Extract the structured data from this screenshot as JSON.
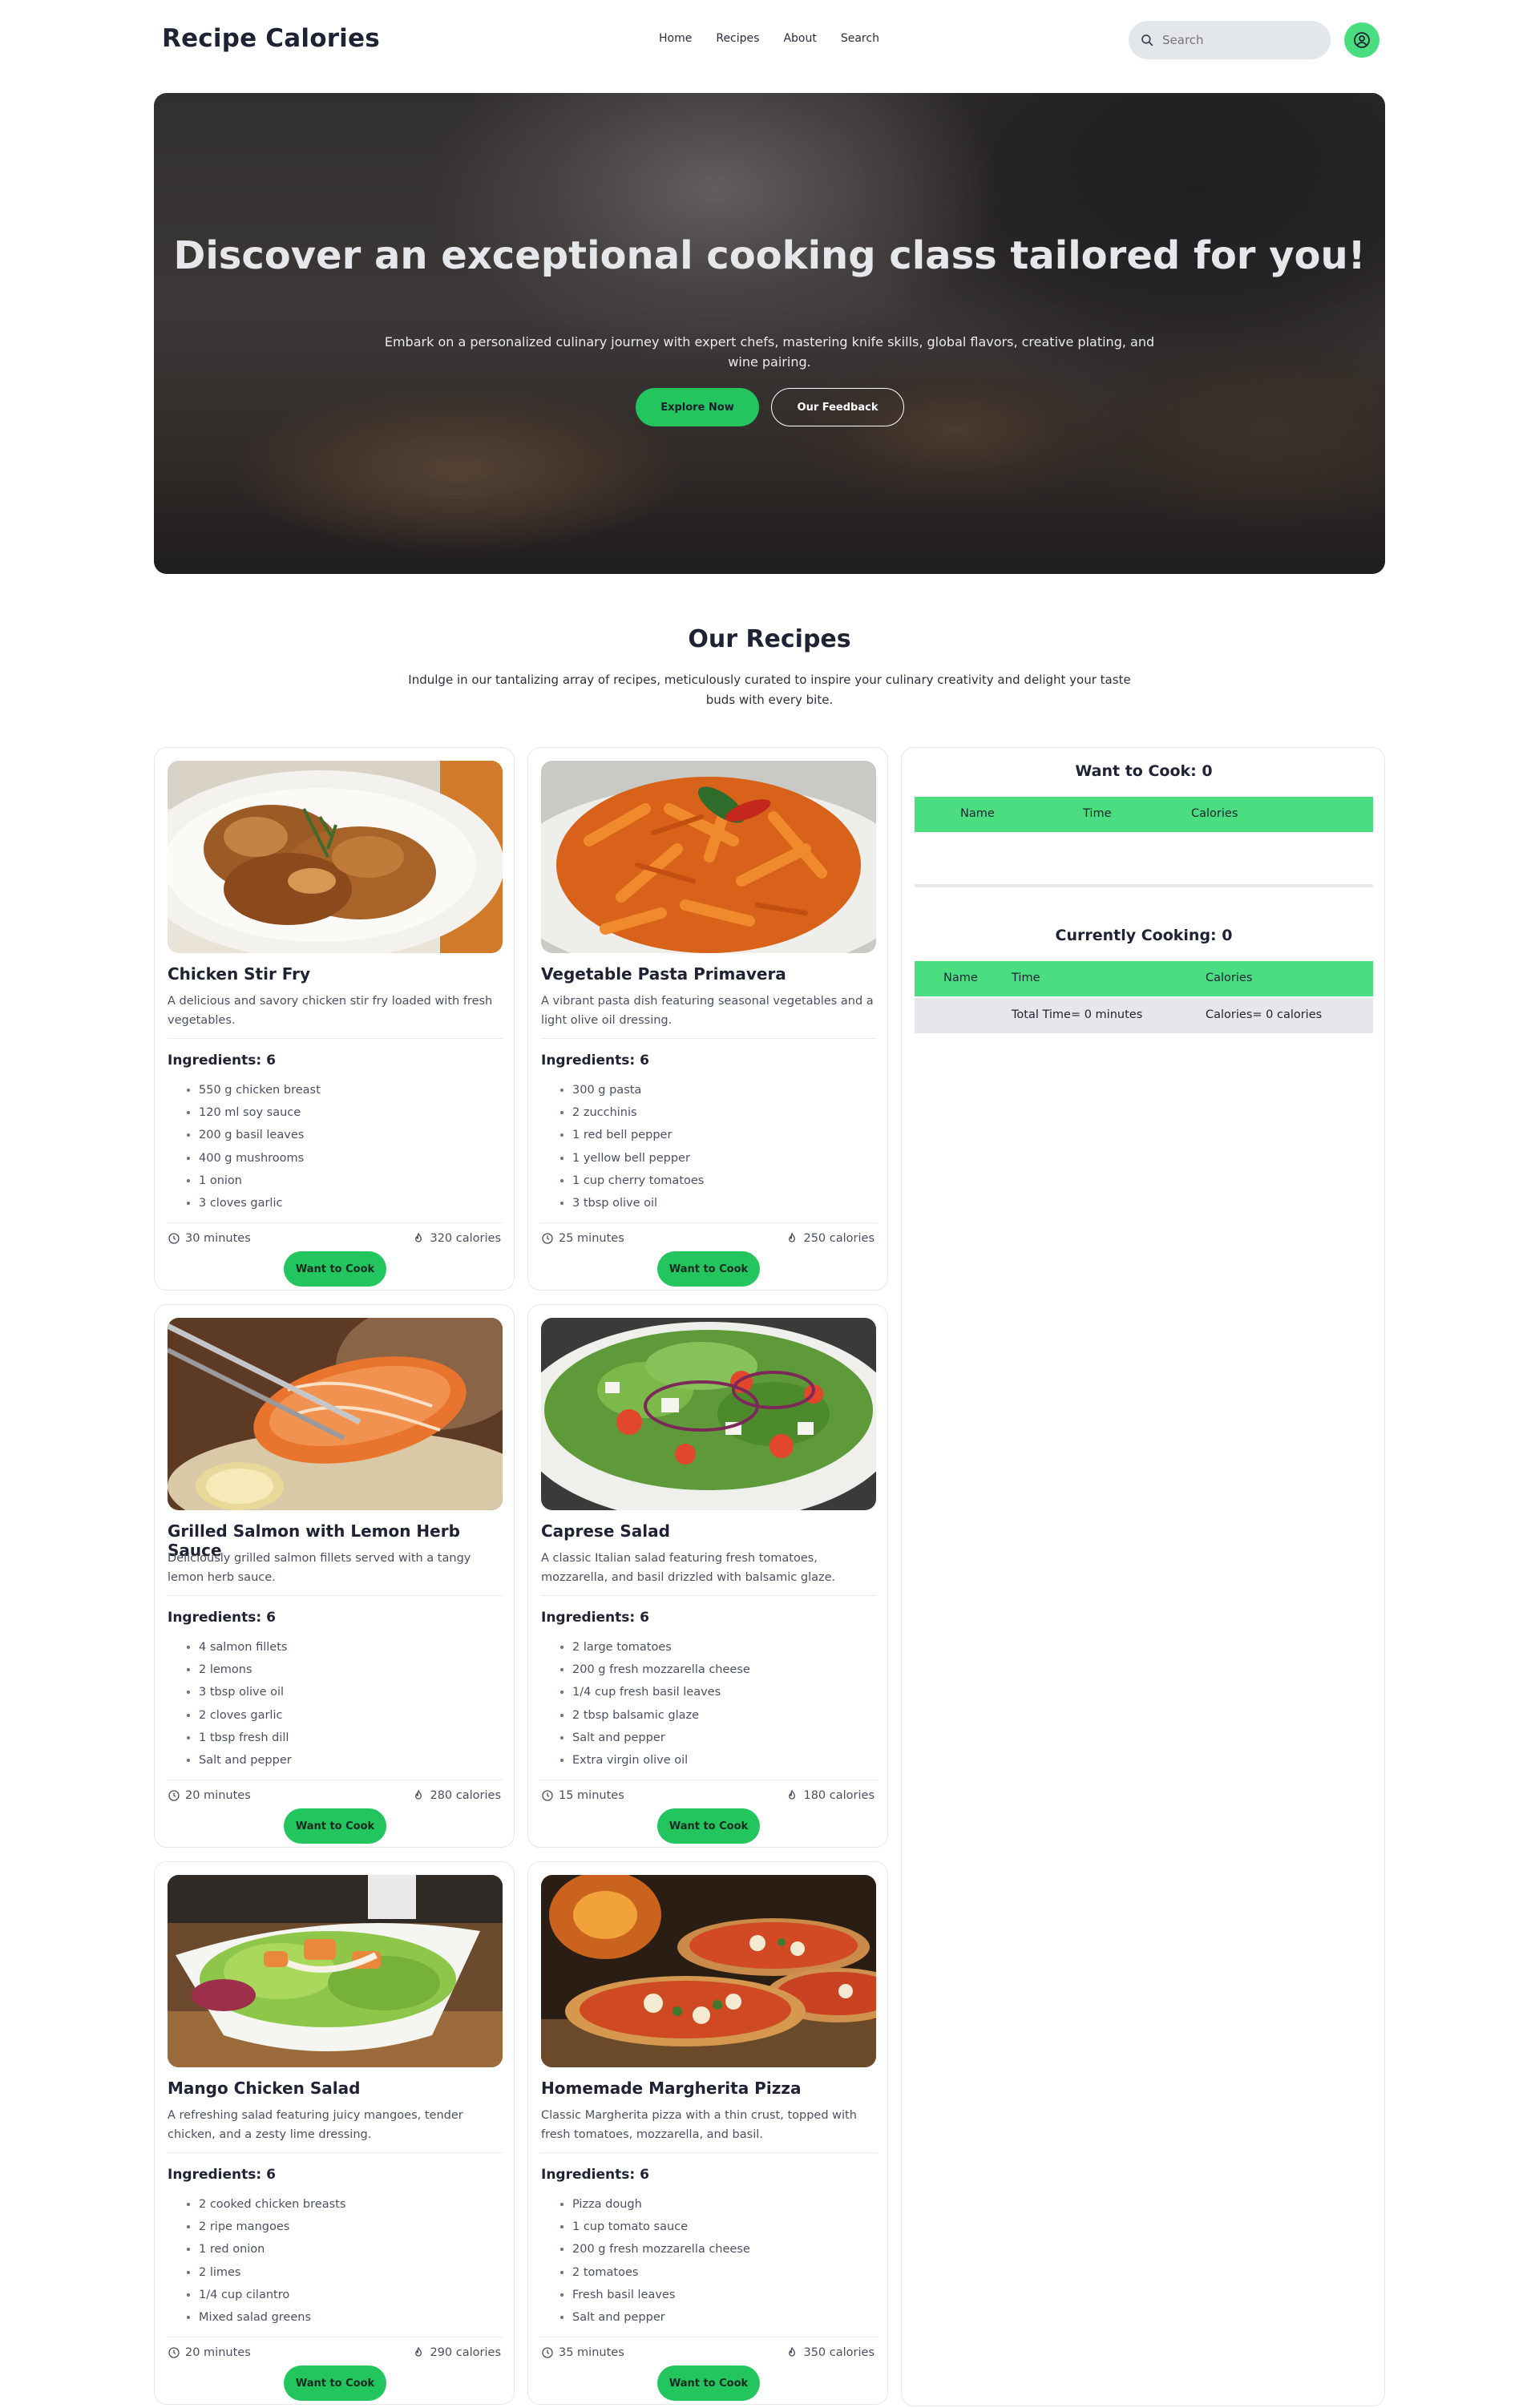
{
  "brand": {
    "name": "Recipe Calories",
    "accent": "#22c55e",
    "accent_light": "#4ade80"
  },
  "nav": {
    "links": [
      "Home",
      "Recipes",
      "About",
      "Search"
    ],
    "search_placeholder": "Search",
    "search_icon": "search-icon",
    "profile_icon": "user-circle-icon"
  },
  "hero": {
    "title": "Discover an exceptional cooking class tailored for you!",
    "subtitle": "Embark on a personalized culinary journey with expert chefs, mastering knife skills, global flavors, creative plating, and wine pairing.",
    "primary_button": "Explore Now",
    "secondary_button": "Our Feedback"
  },
  "recipes_section": {
    "title": "Our Recipes",
    "description": "Indulge in our tantalizing array of recipes, meticulously curated to inspire your culinary creativity and delight your taste buds with every bite."
  },
  "recipes": [
    {
      "name": "Chicken Stir Fry",
      "description": "A delicious and savory chicken stir fry loaded with fresh vegetables.",
      "ingredients_label": "Ingredients: 6",
      "ingredients": [
        "550 g chicken breast",
        "120 ml soy sauce",
        "200 g basil leaves",
        "400 g mushrooms",
        "1 onion",
        "3 cloves garlic"
      ],
      "time": "30 minutes",
      "calories": "320 calories",
      "button": "Want to Cook"
    },
    {
      "name": "Vegetable Pasta Primavera",
      "description": "A vibrant pasta dish featuring seasonal vegetables and a light olive oil dressing.",
      "ingredients_label": "Ingredients: 6",
      "ingredients": [
        "300 g pasta",
        "2 zucchinis",
        "1 red bell pepper",
        "1 yellow bell pepper",
        "1 cup cherry tomatoes",
        "3 tbsp olive oil"
      ],
      "time": "25 minutes",
      "calories": "250 calories",
      "button": "Want to Cook"
    },
    {
      "name": "Grilled Salmon with Lemon Herb Sauce",
      "description": "Deliciously grilled salmon fillets served with a tangy lemon herb sauce.",
      "ingredients_label": "Ingredients: 6",
      "ingredients": [
        "4 salmon fillets",
        "2 lemons",
        "3 tbsp olive oil",
        "2 cloves garlic",
        "1 tbsp fresh dill",
        "Salt and pepper"
      ],
      "time": "20 minutes",
      "calories": "280 calories",
      "button": "Want to Cook"
    },
    {
      "name": "Caprese Salad",
      "description": "A classic Italian salad featuring fresh tomatoes, mozzarella, and basil drizzled with balsamic glaze.",
      "ingredients_label": "Ingredients: 6",
      "ingredients": [
        "2 large tomatoes",
        "200 g fresh mozzarella cheese",
        "1/4 cup fresh basil leaves",
        "2 tbsp balsamic glaze",
        "Salt and pepper",
        "Extra virgin olive oil"
      ],
      "time": "15 minutes",
      "calories": "180 calories",
      "button": "Want to Cook"
    },
    {
      "name": "Mango Chicken Salad",
      "description": "A refreshing salad featuring juicy mangoes, tender chicken, and a zesty lime dressing.",
      "ingredients_label": "Ingredients: 6",
      "ingredients": [
        "2 cooked chicken breasts",
        "2 ripe mangoes",
        "1 red onion",
        "2 limes",
        "1/4 cup cilantro",
        "Mixed salad greens"
      ],
      "time": "20 minutes",
      "calories": "290 calories",
      "button": "Want to Cook"
    },
    {
      "name": "Homemade Margherita Pizza",
      "description": "Classic Margherita pizza with a thin crust, topped with fresh tomatoes, mozzarella, and basil.",
      "ingredients_label": "Ingredients: 6",
      "ingredients": [
        "Pizza dough",
        "1 cup tomato sauce",
        "200 g fresh mozzarella cheese",
        "2 tomatoes",
        "Fresh basil leaves",
        "Salt and pepper"
      ],
      "time": "35 minutes",
      "calories": "350 calories",
      "button": "Want to Cook"
    }
  ],
  "sidebar": {
    "want_to_cook": {
      "title": "Want to Cook: 0",
      "headers": [
        "Name",
        "Time",
        "Calories"
      ]
    },
    "currently_cooking": {
      "title": "Currently Cooking: 0",
      "headers": [
        "Name",
        "Time",
        "Calories"
      ],
      "total_time": "Total Time= 0 minutes",
      "total_calories": "Calories= 0 calories"
    }
  }
}
